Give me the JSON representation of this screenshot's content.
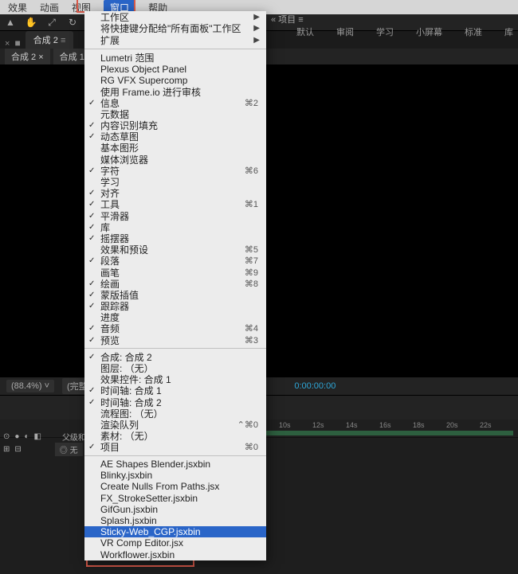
{
  "menubar": {
    "items": [
      "效果",
      "动画",
      "视图",
      "窗口",
      "帮助"
    ],
    "activeIndex": 3
  },
  "workspaces": [
    "默认",
    "审阅",
    "学习",
    "小屏幕",
    "标准",
    "库"
  ],
  "compTab": "合成 2",
  "subTabs": [
    "合成 2",
    "合成 1"
  ],
  "viewerCtrl": {
    "zoom": "(88.4%)",
    "res": "(完整)",
    "time": "0:00:00:00"
  },
  "ruler": [
    "10s",
    "12s",
    "14s",
    "16s",
    "18s",
    "20s",
    "22s"
  ],
  "tlLeft": {
    "parent": "父级和链接",
    "none": "无"
  },
  "menu": {
    "top": [
      {
        "l": "工作区",
        "arr": true
      },
      {
        "l": "将快捷键分配给\"所有面板\"工作区",
        "arr": true
      },
      {
        "l": "扩展",
        "tall": true,
        "arr": true
      }
    ],
    "sep1": true,
    "mid": [
      {
        "l": "Lumetri 范围"
      },
      {
        "l": "Plexus Object Panel"
      },
      {
        "l": "RG VFX Supercomp"
      },
      {
        "l": "使用 Frame.io 进行审核"
      },
      {
        "l": "信息",
        "c": true,
        "s": "⌘2"
      },
      {
        "l": "元数据"
      },
      {
        "l": "内容识别填充",
        "c": true
      },
      {
        "l": "动态草图",
        "c": true
      },
      {
        "l": "基本图形"
      },
      {
        "l": "媒体浏览器"
      },
      {
        "l": "字符",
        "c": true,
        "s": "⌘6"
      },
      {
        "l": "学习"
      },
      {
        "l": "对齐",
        "c": true
      },
      {
        "l": "工具",
        "c": true,
        "s": "⌘1"
      },
      {
        "l": "平滑器",
        "c": true
      },
      {
        "l": "库",
        "c": true
      },
      {
        "l": "摇摆器",
        "c": true
      },
      {
        "l": "效果和预设",
        "s": "⌘5"
      },
      {
        "l": "段落",
        "c": true,
        "s": "⌘7"
      },
      {
        "l": "画笔",
        "s": "⌘9"
      },
      {
        "l": "绘画",
        "c": true,
        "s": "⌘8"
      },
      {
        "l": "蒙版插值",
        "c": true
      },
      {
        "l": "跟踪器",
        "c": true
      },
      {
        "l": "进度"
      },
      {
        "l": "音频",
        "c": true,
        "s": "⌘4"
      },
      {
        "l": "预览",
        "c": true,
        "s": "⌘3"
      }
    ],
    "sep2": true,
    "comp": [
      {
        "l": "合成: 合成 2",
        "c": true
      },
      {
        "l": "图层: （无）"
      },
      {
        "l": "效果控件: 合成 1"
      },
      {
        "l": "时间轴: 合成 1",
        "c": true
      },
      {
        "l": "时间轴: 合成 2",
        "c": true
      },
      {
        "l": "流程图: （无）"
      },
      {
        "l": "渲染队列",
        "s": "⌃⌘0"
      },
      {
        "l": "素材: （无）"
      },
      {
        "l": "项目",
        "c": true,
        "s": "⌘0"
      }
    ],
    "sep3": true,
    "scripts": [
      {
        "l": "AE Shapes Blender.jsxbin"
      },
      {
        "l": "Blinky.jsxbin"
      },
      {
        "l": "Create Nulls From Paths.jsx"
      },
      {
        "l": "FX_StrokeSetter.jsxbin"
      },
      {
        "l": "GifGun.jsxbin"
      },
      {
        "l": "Splash.jsxbin"
      },
      {
        "l": "Sticky-Web_CGP.jsxbin",
        "sel": true
      },
      {
        "l": "VR Comp Editor.jsx"
      },
      {
        "l": "Workflower.jsxbin"
      }
    ]
  },
  "extras": {
    "project_side": "« 项目 ≡"
  }
}
